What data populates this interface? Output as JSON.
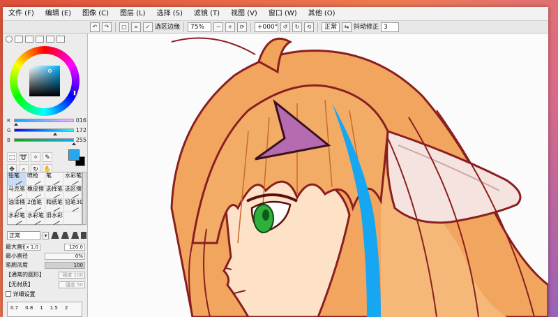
{
  "menu": [
    "文件 (F)",
    "编辑 (E)",
    "图像 (C)",
    "图层 (L)",
    "选择 (S)",
    "滤镜 (T)",
    "视图 (V)",
    "窗口 (W)",
    "其他 (O)"
  ],
  "toolbar": {
    "selection_edge_label": "选区边缘",
    "zoom_value": "75%",
    "angle_value": "+000°",
    "mode_value": "正常",
    "stabilizer_label": "抖动修正",
    "stabilizer_value": "3"
  },
  "color": {
    "current_hex": "#26a8ef",
    "secondary_hex": "#000000",
    "r_label": "R",
    "g_label": "G",
    "b_label": "B",
    "r": "016",
    "g": "172",
    "b": "255"
  },
  "tools": [
    "selection-tool",
    "lasso-tool",
    "magic-wand-tool",
    "eyedropper-tool",
    "move-tool",
    "zoom-tool",
    "rotate-tool",
    "hand-tool"
  ],
  "brushes": [
    "铅笔",
    "喷枪",
    "笔",
    "水彩笔",
    "马克笔",
    "橡皮擦",
    "选择笔",
    "选区擦",
    "油漆桶",
    "2值笔",
    "和纸笔",
    "铅笔30",
    "水彩笔",
    "水彩笔",
    "旧水彩",
    ""
  ],
  "brush_settings": {
    "blend_mode": "正常",
    "max_size_label": "最大直径",
    "max_size_mult": "x 1.0",
    "max_size_value": "120.0",
    "min_size_label": "最小直径",
    "min_size_value": "0%",
    "density_label": "笔刷浓度",
    "density_value": "100",
    "shape_label": "【通常的圆形】",
    "shape_strength_label": "强度",
    "shape_strength_value": "100",
    "texture_label": "【无材质】",
    "texture_strength_label": "强度",
    "texture_strength_value": "50",
    "advanced_label": "详细设置",
    "sizes": [
      "0.7",
      "0.8",
      "1",
      "1.5",
      "2"
    ]
  },
  "colors": {
    "hair": "#f4b06a",
    "hair_shadow": "#e38a3c",
    "outline": "#8a1f1f",
    "stripe": "#16a6f2",
    "ornament": "#b46bb0",
    "eye": "#2fb03a",
    "skin": "#fde2c8",
    "ear": "#f4e3df"
  }
}
